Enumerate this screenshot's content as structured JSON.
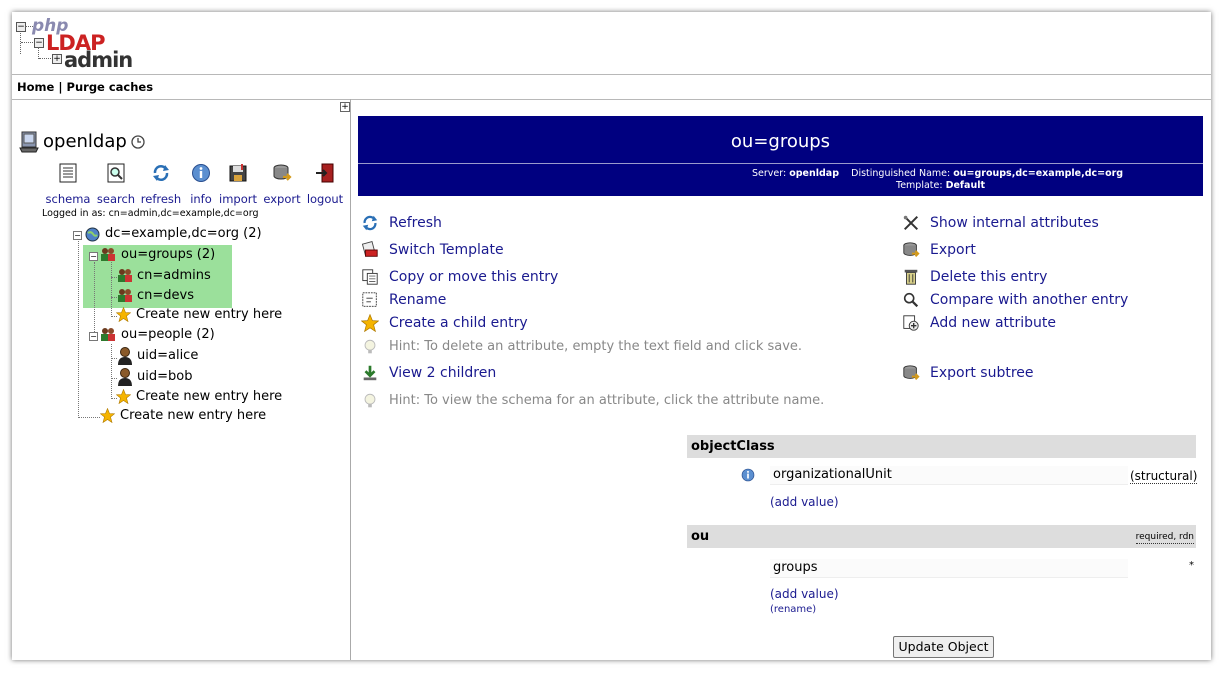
{
  "logo": {
    "php": "php",
    "ldap": "LDAP",
    "admin": "admin"
  },
  "topnav": {
    "home": "Home",
    "separator": " | ",
    "purge": "Purge caches"
  },
  "server": {
    "name": "openldap"
  },
  "toolbar": [
    {
      "label": "schema",
      "icon": "schema-icon"
    },
    {
      "label": "search",
      "icon": "search-icon"
    },
    {
      "label": "refresh",
      "icon": "refresh-icon"
    },
    {
      "label": "info",
      "icon": "info-icon"
    },
    {
      "label": "import",
      "icon": "import-icon"
    },
    {
      "label": "export",
      "icon": "export-icon"
    },
    {
      "label": "logout",
      "icon": "logout-icon"
    }
  ],
  "logged_in": "Logged in as: cn=admin,dc=example,dc=org",
  "tree": {
    "root": "dc=example,dc=org (2)",
    "groups": "ou=groups (2)",
    "admins": "cn=admins",
    "devs": "cn=devs",
    "create_groups": "Create new entry here",
    "people": "ou=people (2)",
    "alice": "uid=alice",
    "bob": "uid=bob",
    "create_people": "Create new entry here",
    "create_root": "Create new entry here"
  },
  "entry": {
    "title": "ou=groups",
    "server_label": "Server:",
    "server_value": "openldap",
    "dn_label": "Distinguished Name:",
    "dn_value": "ou=groups,dc=example,dc=org",
    "template_label": "Template:",
    "template_value": "Default"
  },
  "actions_left": {
    "refresh": "Refresh",
    "switch_template": "Switch Template",
    "copy_move": "Copy or move this entry",
    "rename": "Rename",
    "create_child": "Create a child entry",
    "hint1": "Hint: To delete an attribute, empty the text field and click save.",
    "view_children": "View 2 children",
    "hint2": "Hint: To view the schema for an attribute, click the attribute name."
  },
  "actions_right": {
    "show_internal": "Show internal attributes",
    "export": "Export",
    "delete": "Delete this entry",
    "compare": "Compare with another entry",
    "add_attribute": "Add new attribute",
    "export_subtree": "Export subtree"
  },
  "attributes": {
    "objectclass": {
      "name": "objectClass",
      "value": "organizationalUnit",
      "note": "(structural)",
      "add_value": "(add value)"
    },
    "ou": {
      "name": "ou",
      "flags": "required, rdn",
      "required_mark": "*",
      "value": "groups",
      "add_value": "(add value)",
      "rename": "(rename)"
    }
  },
  "update_button": "Update Object",
  "colors": {
    "title_bg": "#000080",
    "link": "#1a1a8f",
    "highlight": "#9be09b",
    "attr_head": "#dddddd"
  }
}
